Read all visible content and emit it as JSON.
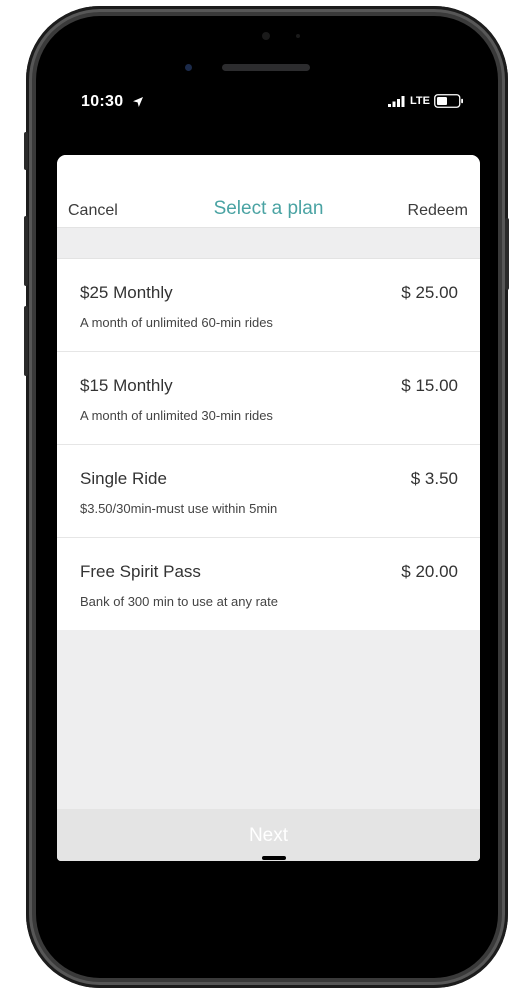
{
  "status_bar": {
    "time": "10:30",
    "network": "LTE"
  },
  "sheet": {
    "cancel_label": "Cancel",
    "title": "Select a plan",
    "redeem_label": "Redeem",
    "next_label": "Next"
  },
  "plans": [
    {
      "name": "$25 Monthly",
      "price": "$ 25.00",
      "description": "A month of unlimited 60-min rides"
    },
    {
      "name": "$15 Monthly",
      "price": "$ 15.00",
      "description": "A month of unlimited 30-min rides"
    },
    {
      "name": "Single Ride",
      "price": "$ 3.50",
      "description": "$3.50/30min-must use within 5min"
    },
    {
      "name": "Free Spirit Pass",
      "price": "$ 20.00",
      "description": "Bank of 300 min to use at any rate"
    }
  ],
  "colors": {
    "accent": "#4aa3a3",
    "sheet_background": "#eeeeef",
    "next_button_background": "#e4e4e4"
  },
  "icons": {
    "location": "location-arrow-icon",
    "signal": "cellular-signal-icon",
    "battery": "battery-icon"
  }
}
